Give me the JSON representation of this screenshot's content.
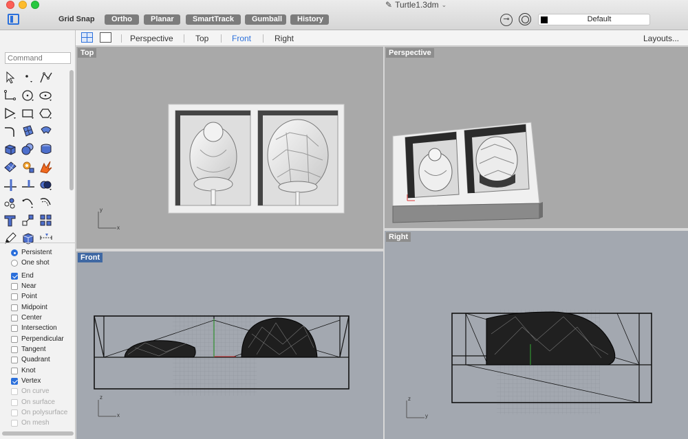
{
  "window": {
    "title": "Turtle1.3dm",
    "file_icon": "file-3dm-icon",
    "dropdown_icon": "chevron-down-icon"
  },
  "toolbar": {
    "grid_snap": "Grid Snap",
    "modes": [
      "Ortho",
      "Planar",
      "SmartTrack",
      "Gumball",
      "History"
    ],
    "layer": "Default"
  },
  "viewport_tabs": {
    "tabs": [
      "Perspective",
      "Top",
      "Front",
      "Right"
    ],
    "active": "Front",
    "layouts": "Layouts..."
  },
  "command": {
    "placeholder": "Command"
  },
  "osnap": {
    "modes": [
      {
        "label": "Persistent",
        "selected": true
      },
      {
        "label": "One shot",
        "selected": false
      }
    ],
    "items": [
      {
        "label": "End",
        "checked": true,
        "enabled": true
      },
      {
        "label": "Near",
        "checked": false,
        "enabled": true
      },
      {
        "label": "Point",
        "checked": false,
        "enabled": true
      },
      {
        "label": "Midpoint",
        "checked": false,
        "enabled": true
      },
      {
        "label": "Center",
        "checked": false,
        "enabled": true
      },
      {
        "label": "Intersection",
        "checked": false,
        "enabled": true
      },
      {
        "label": "Perpendicular",
        "checked": false,
        "enabled": true
      },
      {
        "label": "Tangent",
        "checked": false,
        "enabled": true
      },
      {
        "label": "Quadrant",
        "checked": false,
        "enabled": true
      },
      {
        "label": "Knot",
        "checked": false,
        "enabled": true
      },
      {
        "label": "Vertex",
        "checked": true,
        "enabled": true
      },
      {
        "label": "On curve",
        "checked": false,
        "enabled": false
      },
      {
        "label": "On surface",
        "checked": false,
        "enabled": false
      },
      {
        "label": "On polysurface",
        "checked": false,
        "enabled": false
      },
      {
        "label": "On mesh",
        "checked": false,
        "enabled": false
      }
    ]
  },
  "viewports": {
    "top": {
      "label": "Top",
      "axis_x": "x",
      "axis_y": "y"
    },
    "perspective": {
      "label": "Perspective"
    },
    "front": {
      "label": "Front",
      "axis_x": "x",
      "axis_y": "z"
    },
    "right": {
      "label": "Right",
      "axis_x": "y",
      "axis_y": "z"
    }
  },
  "colors": {
    "accent": "#2a6fdb",
    "mode_button": "#7c7c7c",
    "active_viewport_label": "#3f68a3"
  }
}
